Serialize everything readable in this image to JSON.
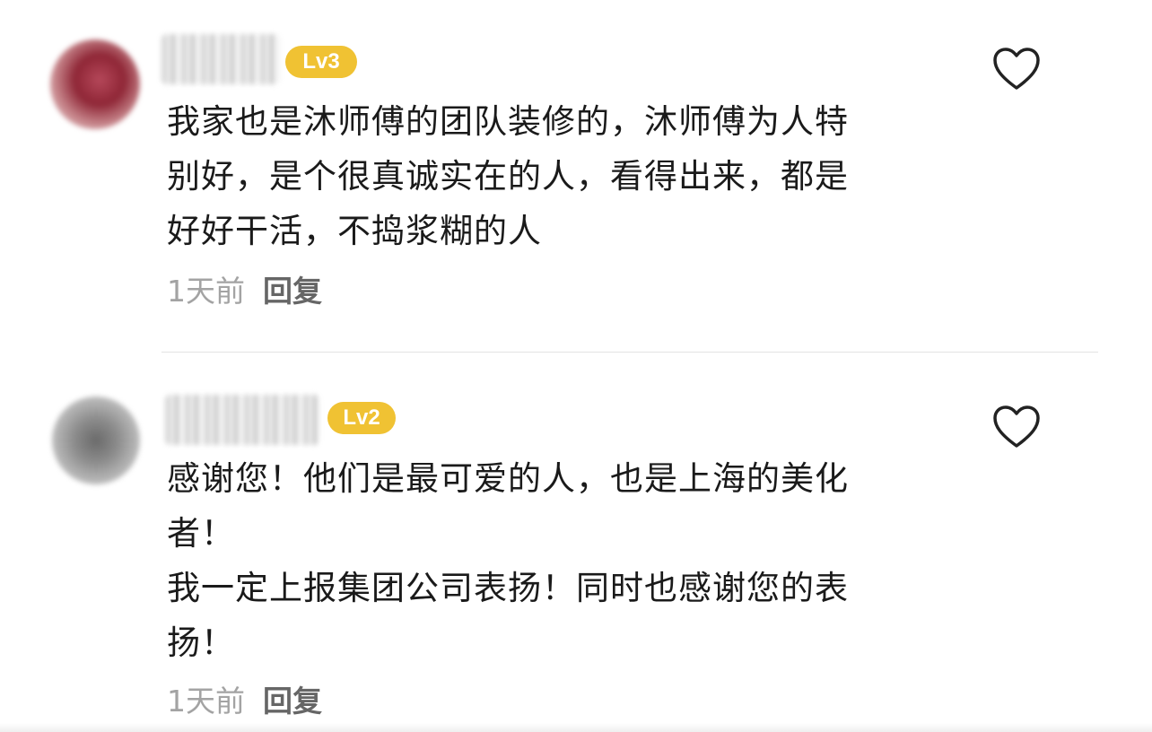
{
  "comments": [
    {
      "level": "Lv3",
      "text_lines": [
        "我家也是沐师傅的团队装修的，沐师傅为人特",
        "别好，是个很真诚实在的人，看得出来，都是",
        "好好干活，不捣浆糊的人"
      ],
      "timestamp": "1天前",
      "reply_label": "回复",
      "like_icon": "heart-outline-icon"
    },
    {
      "level": "Lv2",
      "text_lines": [
        "感谢您！他们是最可爱的人，也是上海的美化",
        "者！",
        "我一定上报集团公司表扬！同时也感谢您的表",
        "扬！"
      ],
      "timestamp": "1天前",
      "reply_label": "回复",
      "like_icon": "heart-outline-icon"
    }
  ],
  "colors": {
    "level_badge": "#f0c233",
    "text": "#1a1a1a",
    "timestamp": "#a3a3a3",
    "reply": "#666666",
    "divider": "#e3e3e3"
  }
}
